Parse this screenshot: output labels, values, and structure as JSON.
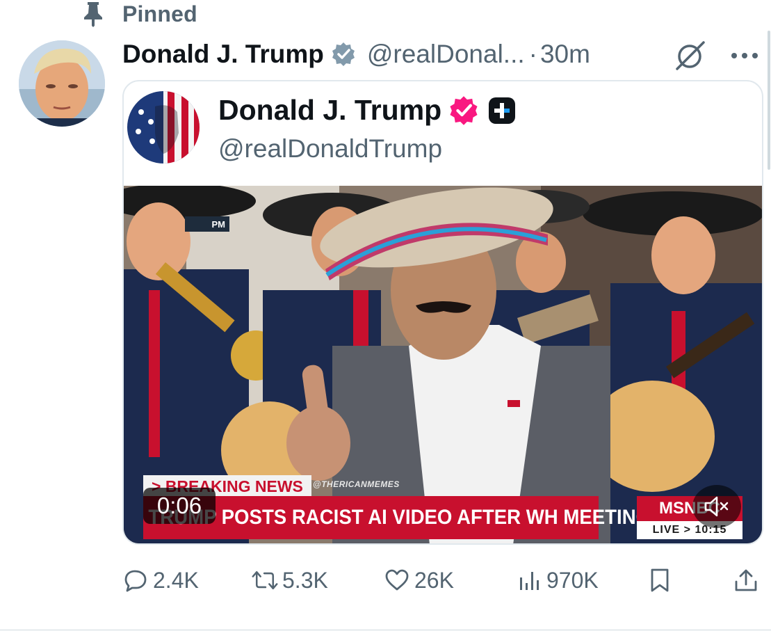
{
  "pinned": {
    "label": "Pinned",
    "icon": "pin-icon"
  },
  "author": {
    "display_name": "Donald J. Trump",
    "handle": "@realDonal...",
    "separator": "·",
    "time": "30m",
    "verified_color": "#829aab"
  },
  "quoted": {
    "display_name": "Donald J. Trump",
    "handle": "@realDonaldTrump",
    "badge_color": "#f91880",
    "plus_icon": "truth-social-plus-icon"
  },
  "media": {
    "duration": "0:06",
    "breaking": "> BREAKING NEWS",
    "watermark": "@THERICANMEMES",
    "headline": "TRUMP POSTS RACIST AI VIDEO AFTER WH MEETING W/ DEMS",
    "network": "MSNBC",
    "live": "LIVE > 10:15",
    "top_time": "PM",
    "muted": true
  },
  "actions": {
    "replies": "2.4K",
    "reposts": "5.3K",
    "likes": "26K",
    "views": "970K"
  },
  "colors": {
    "text": "#0f1419",
    "muted": "#536471",
    "border": "#e1e8ed",
    "chyron": "#c8102e"
  }
}
